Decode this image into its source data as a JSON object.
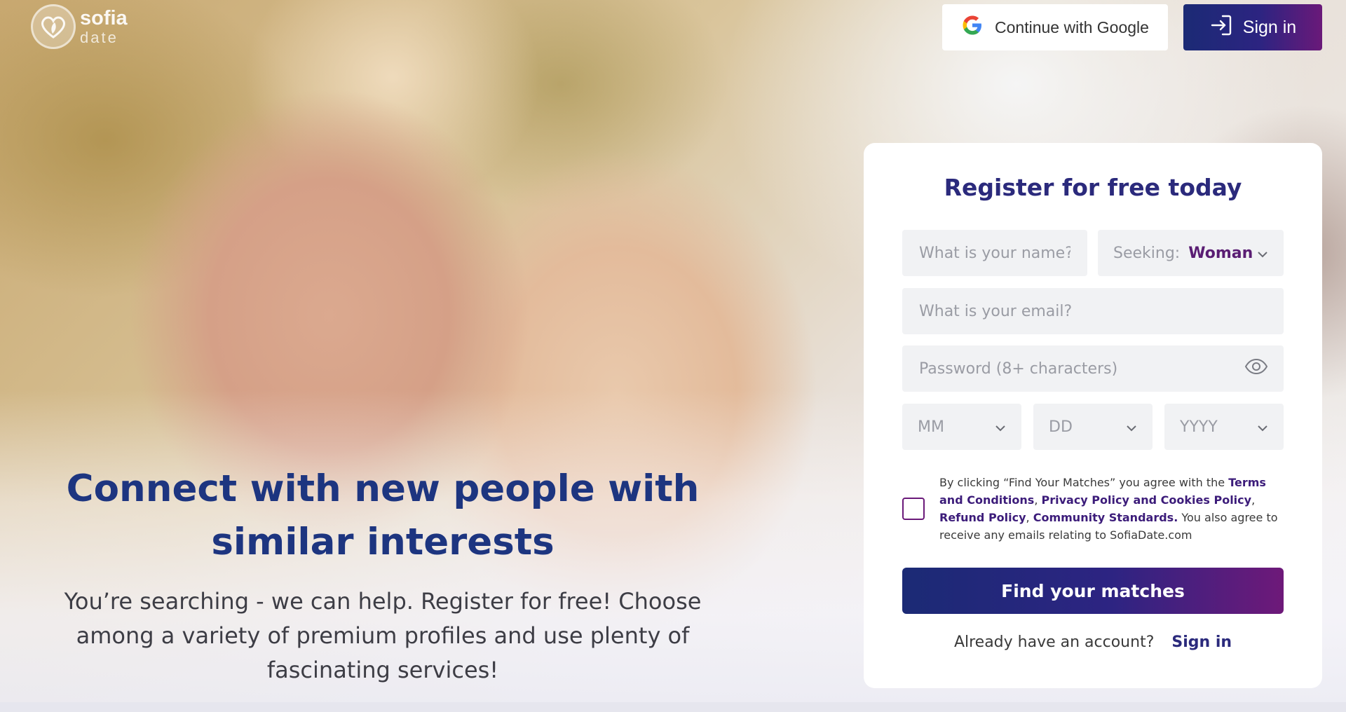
{
  "brand": {
    "name_line1": "sofia",
    "name_line2": "date"
  },
  "header": {
    "google_label": "Continue with Google",
    "signin_label": "Sign in"
  },
  "hero": {
    "title": "Connect with new people with similar interests",
    "subtitle": "You’re searching - we can help. Register for free! Choose among a variety of premium profiles and use plenty of fascinating services!"
  },
  "register": {
    "title": "Register for free today",
    "name_placeholder": "What is your name?",
    "seeking_label": "Seeking:",
    "seeking_value": "Woman",
    "email_placeholder": "What is your email?",
    "password_placeholder": "Password (8+ characters)",
    "month_placeholder": "MM",
    "day_placeholder": "DD",
    "year_placeholder": "YYYY",
    "terms": {
      "prefix": "By clicking “Find Your Matches” you agree with the ",
      "terms_link": "Terms and Conditions",
      "sep1": ", ",
      "privacy_link": "Privacy Policy and Cookies Policy",
      "sep2": ", ",
      "refund_link": "Refund Policy",
      "sep3": ", ",
      "community_link": "Community Standards.",
      "suffix": "  You also agree to receive any emails relating to SofiaDate.com"
    },
    "submit_label": "Find your matches",
    "have_account_text": "Already have an account?",
    "signin_link": "Sign in"
  },
  "colors": {
    "brand_navy": "#1b2a75",
    "brand_purple": "#6a1979",
    "title_blue": "#1d3580"
  }
}
